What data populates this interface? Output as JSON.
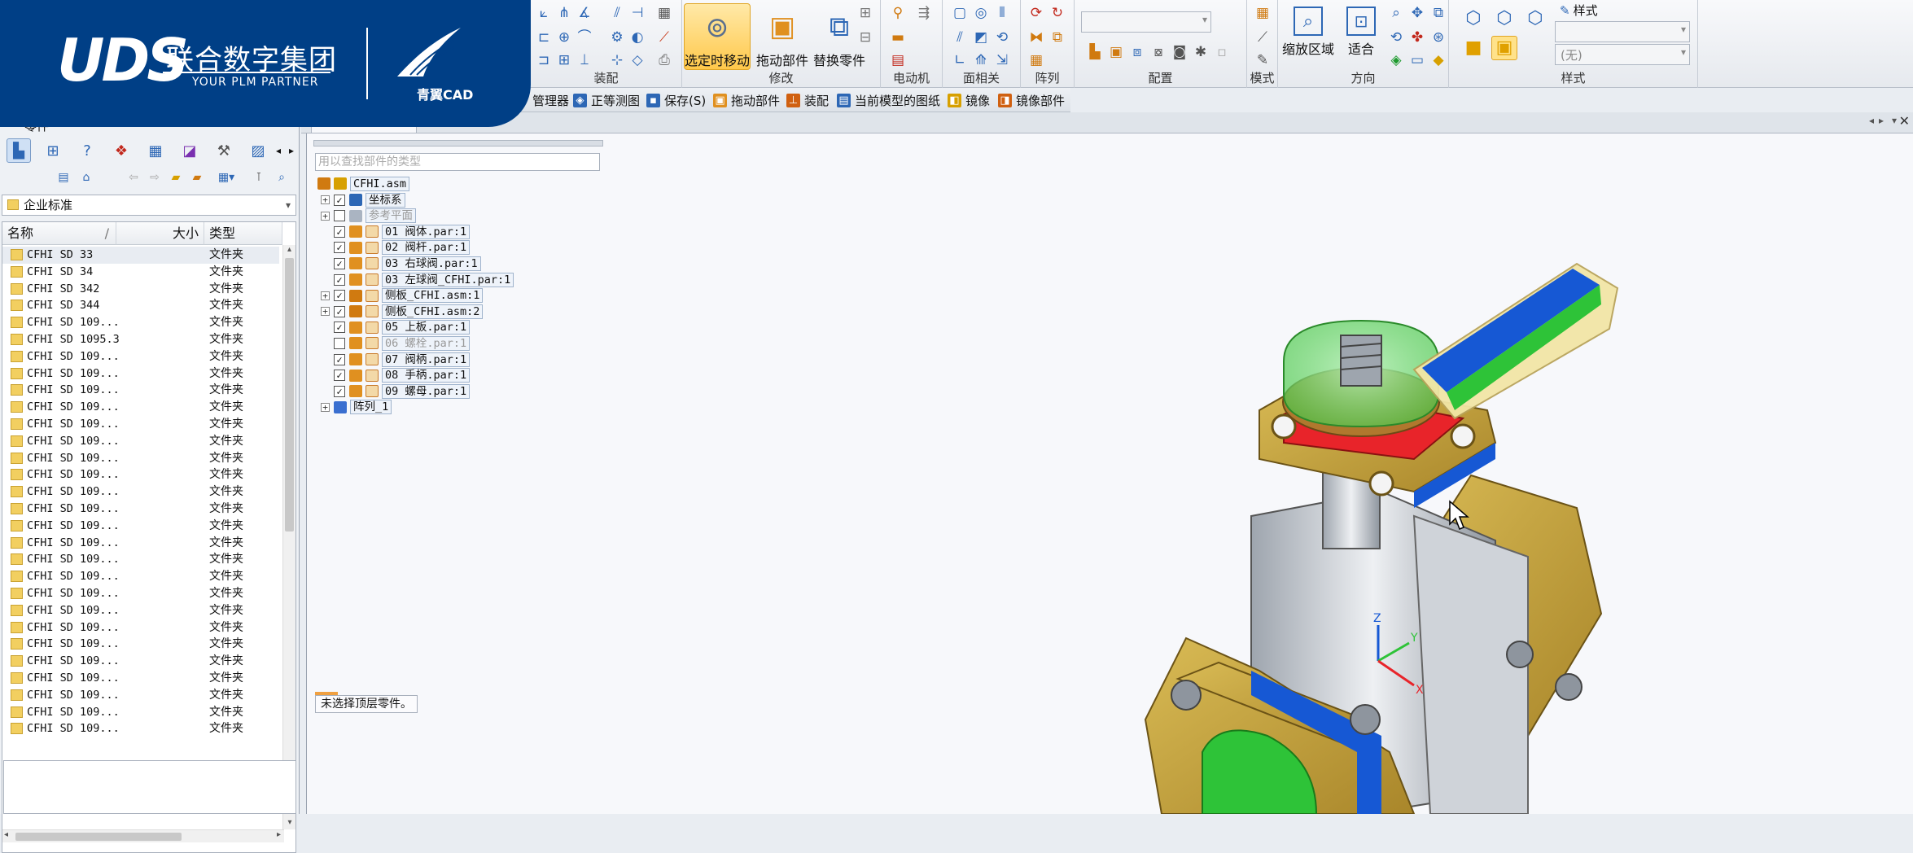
{
  "logo": {
    "brand": "UDS",
    "cn": "联合数字集团",
    "tagline": "YOUR PLM PARTNER",
    "sub_brand": "青翼CAD"
  },
  "ribbon": {
    "groups": [
      "装配",
      "修改",
      "电动机",
      "面相关",
      "阵列",
      "配置",
      "模式",
      "方向",
      "样式"
    ],
    "select_move_label": "选定时移动",
    "drag_component_label": "拖动部件",
    "replace_part_label": "替换零件",
    "zoom_area_label": "缩放区域",
    "fit_label": "适合",
    "style_label": "样式",
    "style_value": "(无)"
  },
  "quickbar": [
    {
      "label": "管理器",
      "icon": "manager-icon"
    },
    {
      "label": "正等测图",
      "icon": "iso-view-icon"
    },
    {
      "label": "保存(S)",
      "icon": "save-icon"
    },
    {
      "label": "拖动部件",
      "icon": "drag-icon"
    },
    {
      "label": "装配",
      "icon": "assembly-icon"
    },
    {
      "label": "当前模型的图纸",
      "icon": "drawing-icon"
    },
    {
      "label": "镜像",
      "icon": "mirror-icon"
    },
    {
      "label": "镜像部件",
      "icon": "mirror-part-icon"
    }
  ],
  "leftpanel": {
    "title": "零件",
    "category": "企业标准",
    "columns": {
      "name": "名称",
      "size": "大小",
      "type": "类型"
    },
    "files": [
      {
        "name": "CFHI SD 33",
        "type": "文件夹"
      },
      {
        "name": "CFHI SD 34",
        "type": "文件夹"
      },
      {
        "name": "CFHI SD 342",
        "type": "文件夹"
      },
      {
        "name": "CFHI SD 344",
        "type": "文件夹"
      },
      {
        "name": "CFHI SD 109...",
        "type": "文件夹"
      },
      {
        "name": "CFHI SD 1095.3",
        "type": "文件夹"
      },
      {
        "name": "CFHI SD 109...",
        "type": "文件夹"
      },
      {
        "name": "CFHI SD 109...",
        "type": "文件夹"
      },
      {
        "name": "CFHI SD 109...",
        "type": "文件夹"
      },
      {
        "name": "CFHI SD 109...",
        "type": "文件夹"
      },
      {
        "name": "CFHI SD 109...",
        "type": "文件夹"
      },
      {
        "name": "CFHI SD 109...",
        "type": "文件夹"
      },
      {
        "name": "CFHI SD 109...",
        "type": "文件夹"
      },
      {
        "name": "CFHI SD 109...",
        "type": "文件夹"
      },
      {
        "name": "CFHI SD 109...",
        "type": "文件夹"
      },
      {
        "name": "CFHI SD 109...",
        "type": "文件夹"
      },
      {
        "name": "CFHI SD 109...",
        "type": "文件夹"
      },
      {
        "name": "CFHI SD 109...",
        "type": "文件夹"
      },
      {
        "name": "CFHI SD 109...",
        "type": "文件夹"
      },
      {
        "name": "CFHI SD 109...",
        "type": "文件夹"
      },
      {
        "name": "CFHI SD 109...",
        "type": "文件夹"
      },
      {
        "name": "CFHI SD 109...",
        "type": "文件夹"
      },
      {
        "name": "CFHI SD 109...",
        "type": "文件夹"
      },
      {
        "name": "CFHI SD 109...",
        "type": "文件夹"
      },
      {
        "name": "CFHI SD 109...",
        "type": "文件夹"
      },
      {
        "name": "CFHI SD 109...",
        "type": "文件夹"
      },
      {
        "name": "CFHI SD 109...",
        "type": "文件夹"
      },
      {
        "name": "CFHI SD 109...",
        "type": "文件夹"
      },
      {
        "name": "CFHI SD 109...",
        "type": "文件夹"
      }
    ]
  },
  "tree": {
    "search_placeholder": "用以查找部件的类型",
    "root": "CFHI.asm",
    "nodes": [
      {
        "label": "坐标系",
        "checked": true,
        "expandable": true,
        "kind": "coord"
      },
      {
        "label": "参考平面",
        "checked": false,
        "expandable": true,
        "kind": "plane"
      },
      {
        "label": "01 阀体.par:1",
        "checked": true,
        "expandable": false,
        "kind": "part"
      },
      {
        "label": "02 阀杆.par:1",
        "checked": true,
        "expandable": false,
        "kind": "part"
      },
      {
        "label": "03 右球阀.par:1",
        "checked": true,
        "expandable": false,
        "kind": "part"
      },
      {
        "label": "03 左球阀_CFHI.par:1",
        "checked": true,
        "expandable": false,
        "kind": "part"
      },
      {
        "label": "侧板_CFHI.asm:1",
        "checked": true,
        "expandable": true,
        "kind": "asm"
      },
      {
        "label": "侧板_CFHI.asm:2",
        "checked": true,
        "expandable": true,
        "kind": "asm"
      },
      {
        "label": "05 上板.par:1",
        "checked": true,
        "expandable": false,
        "kind": "part"
      },
      {
        "label": "06 螺栓.par:1",
        "checked": false,
        "expandable": false,
        "kind": "part"
      },
      {
        "label": "07 阀柄.par:1",
        "checked": true,
        "expandable": false,
        "kind": "part"
      },
      {
        "label": "08 手柄.par:1",
        "checked": true,
        "expandable": false,
        "kind": "part"
      },
      {
        "label": "09 螺母.par:1",
        "checked": true,
        "expandable": false,
        "kind": "part"
      },
      {
        "label": "阵列_1",
        "checked": null,
        "expandable": true,
        "kind": "pattern"
      }
    ],
    "status": "未选择顶层零件。"
  },
  "colors": {
    "brand_blue": "#003f86",
    "part_gold": "#c7a53a",
    "face_red": "#e8242a",
    "face_blue": "#1658d4",
    "face_green": "#2ec338"
  }
}
